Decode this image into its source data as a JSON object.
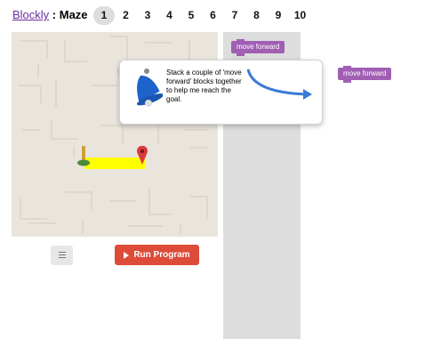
{
  "header": {
    "app_link": "Blockly",
    "separator": " : ",
    "page_name": "Maze",
    "levels": [
      "1",
      "2",
      "3",
      "4",
      "5",
      "6",
      "7",
      "8",
      "9",
      "10"
    ],
    "active_level": "1"
  },
  "toolbox": {
    "block_label": "move forward"
  },
  "workspace": {
    "block_label": "move forward"
  },
  "hint": {
    "text": "Stack a couple of 'move forward' blocks together to help me reach the goal."
  },
  "controls": {
    "run_label": "Run Program"
  },
  "colors": {
    "block": "#a05fb3",
    "run_button": "#dd4b39",
    "path": "#ffff00",
    "goal_marker": "#d93a3a",
    "arrow": "#3a7bd5",
    "bell": "#1e63c9"
  },
  "icons": [
    "bell-icon",
    "curved-arrow-icon",
    "goal-marker-icon",
    "pegman-icon",
    "play-icon",
    "menu-lines-icon"
  ]
}
